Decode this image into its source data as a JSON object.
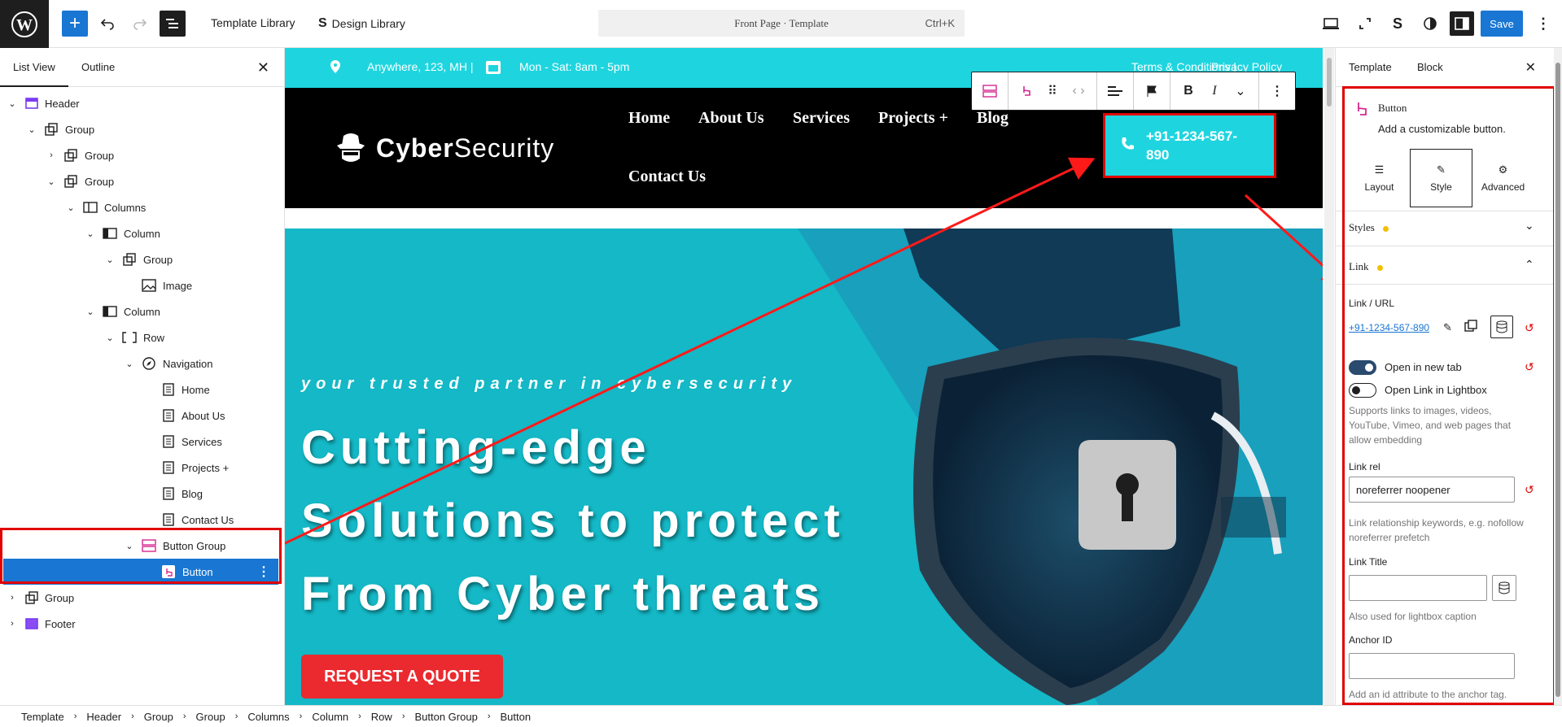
{
  "topbar": {
    "template_library": "Template Library",
    "design_library": "Design Library",
    "command": "Front Page · Template",
    "shortcut": "Ctrl+K",
    "save_label": "Save"
  },
  "list_panel": {
    "tabs": [
      "List View",
      "Outline"
    ],
    "items": [
      {
        "label": "Header"
      },
      {
        "label": "Group"
      },
      {
        "label": "Group"
      },
      {
        "label": "Group"
      },
      {
        "label": "Columns"
      },
      {
        "label": "Column"
      },
      {
        "label": "Group"
      },
      {
        "label": "Image"
      },
      {
        "label": "Column"
      },
      {
        "label": "Row"
      },
      {
        "label": "Navigation"
      },
      {
        "label": "Home"
      },
      {
        "label": "About Us"
      },
      {
        "label": "Services"
      },
      {
        "label": "Projects +"
      },
      {
        "label": "Blog"
      },
      {
        "label": "Contact Us"
      },
      {
        "label": "Button Group"
      },
      {
        "label": "Button"
      },
      {
        "label": "Group"
      },
      {
        "label": "Footer"
      }
    ]
  },
  "canvas": {
    "address": "Anywhere, 123, MH |",
    "hours": "Mon - Sat: 8am - 5pm",
    "terms": "Terms & Conditions |",
    "privacy": "Privacy Policy",
    "brand_bold": "Cyber",
    "brand_rest": "Security",
    "nav": [
      "Home",
      "About Us",
      "Services",
      "Projects +",
      "Blog",
      "Contact Us"
    ],
    "phone_line1": "+91-1234-567-",
    "phone_line2": "890",
    "hero_sub": "your trusted partner in cybersecurity",
    "hero_lines": [
      "Cutting-edge",
      "Solutions to protect",
      "From Cyber threats"
    ],
    "cta": "REQUEST A QUOTE"
  },
  "inspector": {
    "tabs": [
      "Template",
      "Block"
    ],
    "block_name": "Button",
    "block_desc": "Add a customizable button.",
    "subtabs": [
      "Layout",
      "Style",
      "Advanced"
    ],
    "styles_label": "Styles",
    "link_label": "Link",
    "link_url_label": "Link / URL",
    "link_url_value": "+91-1234-567-890",
    "open_new_tab": "Open in new tab",
    "open_lightbox": "Open Link in Lightbox",
    "lightbox_help": "Supports links to images, videos, YouTube, Vimeo, and web pages that allow embedding",
    "link_rel_label": "Link rel",
    "link_rel_value": "noreferrer noopener",
    "link_rel_help": "Link relationship keywords, e.g. nofollow noreferrer prefetch",
    "link_title_label": "Link Title",
    "link_title_help": "Also used for lightbox caption",
    "anchor_label": "Anchor ID",
    "anchor_help": "Add an id attribute to the anchor tag."
  },
  "breadcrumbs": [
    "Template",
    "Header",
    "Group",
    "Group",
    "Columns",
    "Column",
    "Row",
    "Button Group",
    "Button"
  ],
  "colors": {
    "accent": "#1976d2",
    "highlight": "#e00000",
    "cyan": "#1ed5df",
    "cta": "#ea2a2f"
  }
}
